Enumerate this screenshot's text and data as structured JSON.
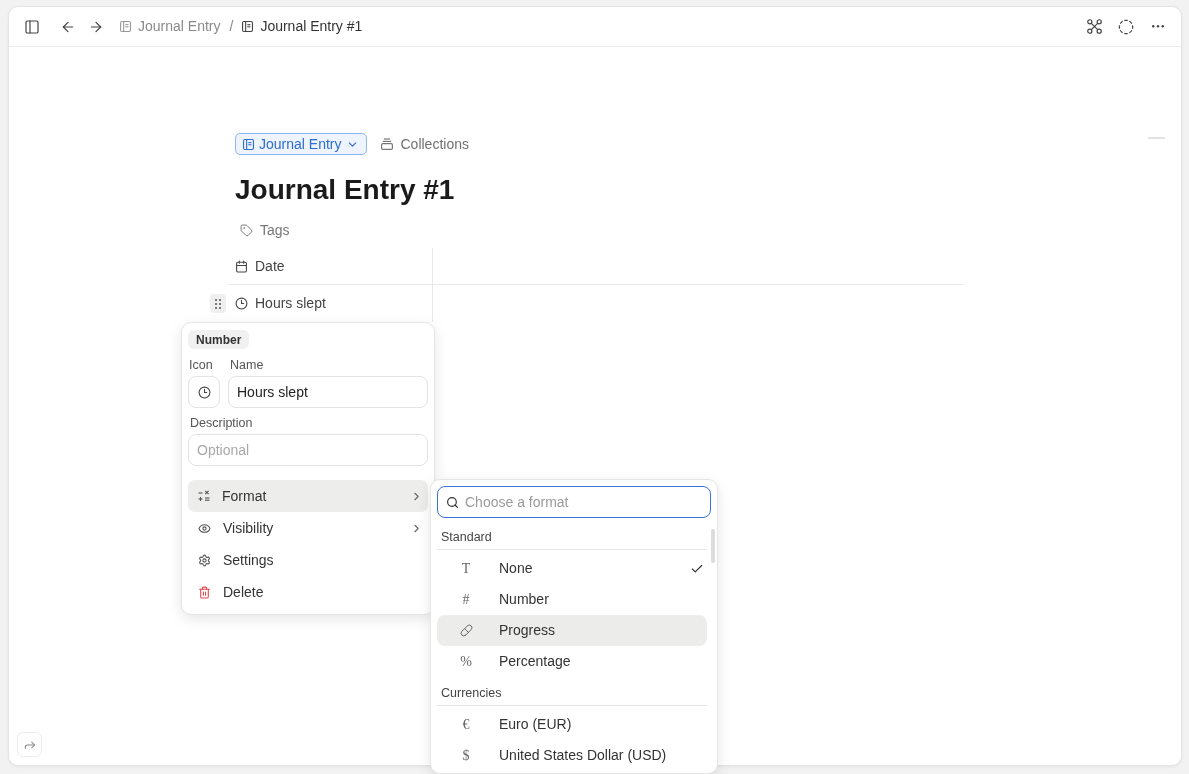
{
  "topbar": {
    "breadcrumbs": [
      {
        "label": "Journal Entry",
        "current": false
      },
      {
        "label": "Journal Entry #1",
        "current": true
      }
    ],
    "separator": "/"
  },
  "page": {
    "template": "Journal Entry",
    "collection": "Collections",
    "title": "Journal Entry #1",
    "tags": "Tags",
    "properties": [
      {
        "name": "Date",
        "kind": "date",
        "editing": false
      },
      {
        "name": "Hours slept",
        "kind": "number",
        "editing": true
      }
    ]
  },
  "property_editor": {
    "type_chip": "Number",
    "icon_label": "Icon",
    "name_label": "Name",
    "name_value": "Hours slept",
    "description_label": "Description",
    "description_placeholder": "Optional",
    "menu": [
      {
        "label": "Format",
        "kind": "submenu",
        "selected": true
      },
      {
        "label": "Visibility",
        "kind": "submenu",
        "selected": false
      },
      {
        "label": "Settings",
        "kind": "action",
        "selected": false
      },
      {
        "label": "Delete",
        "kind": "danger",
        "selected": false
      }
    ]
  },
  "format_menu": {
    "search_placeholder": "Choose a format",
    "sections": [
      {
        "title": "Standard",
        "items": [
          {
            "symbol": "T",
            "label": "None",
            "checked": true,
            "selected": false
          },
          {
            "symbol": "#",
            "label": "Number",
            "checked": false,
            "selected": false
          },
          {
            "label": "Progress",
            "checked": false,
            "selected": true
          },
          {
            "symbol": "%",
            "label": "Percentage",
            "checked": false,
            "selected": false
          }
        ]
      },
      {
        "title": "Currencies",
        "items": [
          {
            "symbol": "€",
            "label": "Euro (EUR)",
            "checked": false,
            "selected": false
          },
          {
            "symbol": "$",
            "label": "United States Dollar (USD)",
            "checked": false,
            "selected": false
          }
        ]
      }
    ]
  }
}
